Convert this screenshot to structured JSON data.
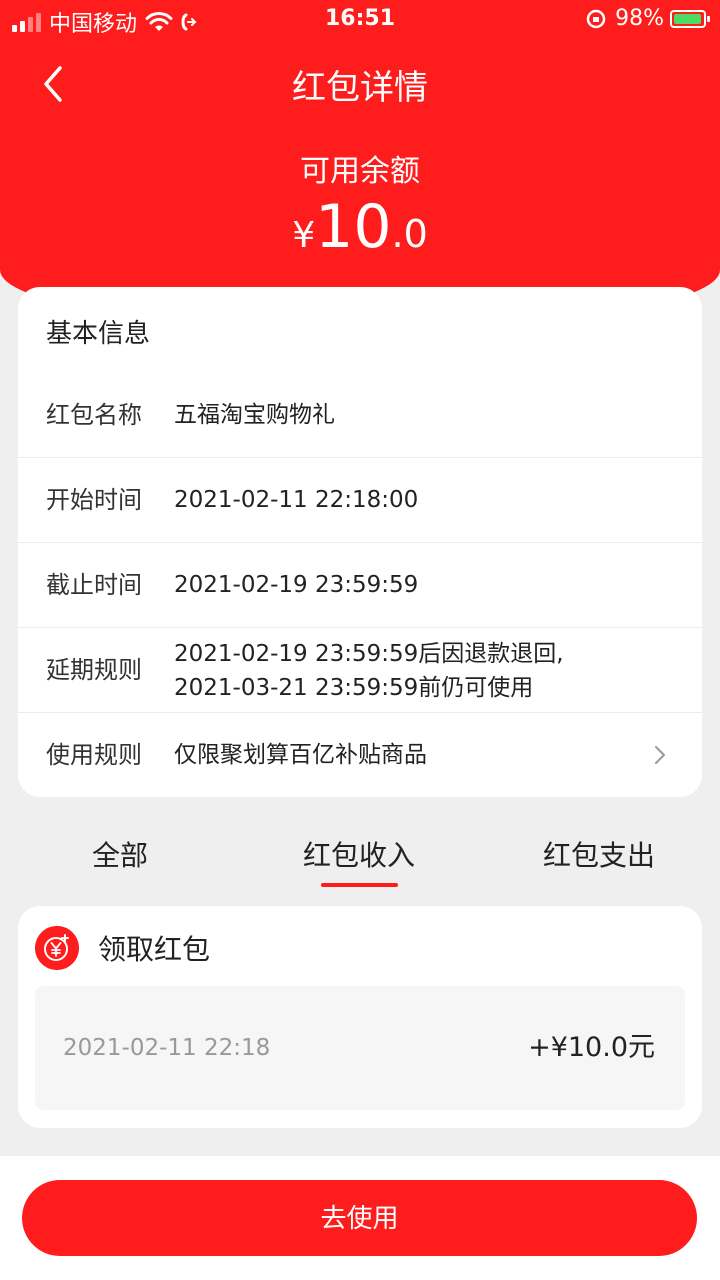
{
  "status_bar": {
    "carrier": "中国移动",
    "time": "16:51",
    "battery": "98%"
  },
  "nav": {
    "title": "红包详情",
    "back_icon": "chevron-left-icon"
  },
  "balance": {
    "label": "可用余额",
    "currency": "¥",
    "integer": "10",
    "decimal": ".0"
  },
  "info": {
    "title": "基本信息",
    "rows": [
      {
        "label": "红包名称",
        "value": "五福淘宝购物礼"
      },
      {
        "label": "开始时间",
        "value": "2021-02-11 22:18:00"
      },
      {
        "label": "截止时间",
        "value": "2021-02-19 23:59:59"
      },
      {
        "label": "延期规则",
        "value_line1": "2021-02-19 23:59:59后因退款退回,",
        "value_line2": "2021-03-21 23:59:59前仍可使用"
      },
      {
        "label": "使用规则",
        "value": "仅限聚划算百亿补贴商品"
      }
    ]
  },
  "tabs": [
    {
      "label": "全部"
    },
    {
      "label": "红包收入"
    },
    {
      "label": "红包支出"
    }
  ],
  "record": {
    "icon": "red-packet-yuan-icon",
    "title": "领取红包",
    "time": "2021-02-11 22:18",
    "amount": "+¥10.0元"
  },
  "action": {
    "use_label": "去使用"
  },
  "colors": {
    "brand_red": "#fe1d1c",
    "background": "#efefef"
  }
}
